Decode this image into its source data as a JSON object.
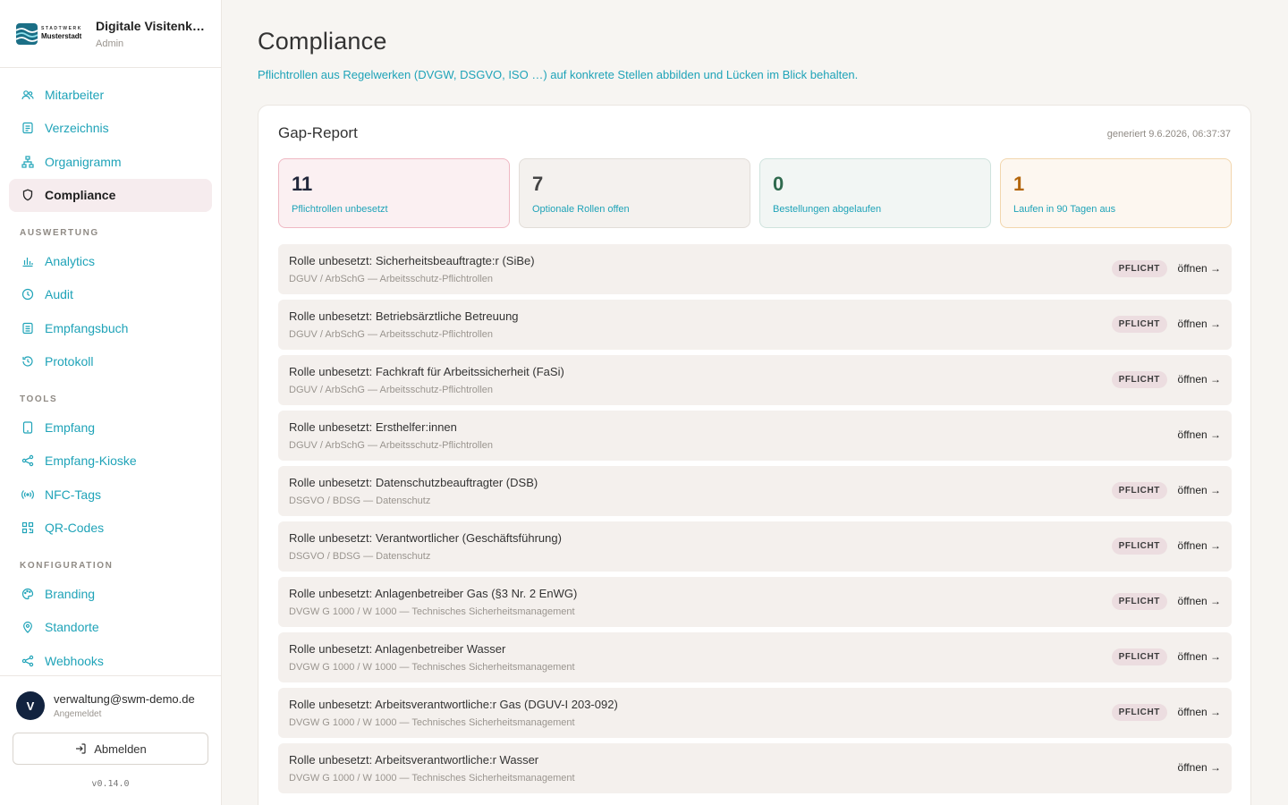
{
  "brand": {
    "logo_small": "STADTWERK",
    "logo_big": "Musterstadt",
    "title": "Digitale Visitenkarten",
    "subtitle": "Admin"
  },
  "nav": {
    "items_main": [
      {
        "label": "Mitarbeiter",
        "icon": "users-icon"
      },
      {
        "label": "Verzeichnis",
        "icon": "list-icon"
      },
      {
        "label": "Organigramm",
        "icon": "org-chart-icon"
      },
      {
        "label": "Compliance",
        "icon": "shield-icon",
        "active": true
      }
    ],
    "section_auswertung": "AUSWERTUNG",
    "items_auswertung": [
      {
        "label": "Analytics",
        "icon": "bar-chart-icon"
      },
      {
        "label": "Audit",
        "icon": "clock-icon"
      },
      {
        "label": "Empfangsbuch",
        "icon": "document-icon"
      },
      {
        "label": "Protokoll",
        "icon": "history-icon"
      }
    ],
    "section_tools": "TOOLS",
    "items_tools": [
      {
        "label": "Empfang",
        "icon": "tablet-icon"
      },
      {
        "label": "Empfang-Kioske",
        "icon": "share-icon"
      },
      {
        "label": "NFC-Tags",
        "icon": "nfc-icon"
      },
      {
        "label": "QR-Codes",
        "icon": "qr-icon"
      }
    ],
    "section_konfiguration": "KONFIGURATION",
    "items_konfiguration": [
      {
        "label": "Branding",
        "icon": "palette-icon"
      },
      {
        "label": "Standorte",
        "icon": "map-pin-icon"
      },
      {
        "label": "Webhooks",
        "icon": "webhook-icon"
      }
    ]
  },
  "user": {
    "initial": "V",
    "email": "verwaltung@swm-demo.de",
    "status": "Angemeldet",
    "logout_label": "Abmelden",
    "version": "v0.14.0"
  },
  "page": {
    "title": "Compliance",
    "subtitle": "Pflichtrollen aus Regelwerken (DVGW, DSGVO, ISO …) auf konkrete Stellen abbilden und Lücken im Blick behalten."
  },
  "report": {
    "title": "Gap-Report",
    "generated": "generiert 9.6.2026, 06:37:37",
    "stats": [
      {
        "value": "11",
        "label": "Pflichtrollen unbesetzt"
      },
      {
        "value": "7",
        "label": "Optionale Rollen offen"
      },
      {
        "value": "0",
        "label": "Bestellungen abgelaufen"
      },
      {
        "value": "1",
        "label": "Laufen in 90 Tagen aus"
      }
    ],
    "badge_label": "PFLICHT",
    "open_label": "öffnen →",
    "rows": [
      {
        "title": "Rolle unbesetzt: Sicherheitsbeauftragte:r (SiBe)",
        "source": "DGUV / ArbSchG — Arbeitsschutz-Pflichtrollen",
        "required": true
      },
      {
        "title": "Rolle unbesetzt: Betriebsärztliche Betreuung",
        "source": "DGUV / ArbSchG — Arbeitsschutz-Pflichtrollen",
        "required": true
      },
      {
        "title": "Rolle unbesetzt: Fachkraft für Arbeitssicherheit (FaSi)",
        "source": "DGUV / ArbSchG — Arbeitsschutz-Pflichtrollen",
        "required": true
      },
      {
        "title": "Rolle unbesetzt: Ersthelfer:innen",
        "source": "DGUV / ArbSchG — Arbeitsschutz-Pflichtrollen",
        "required": false
      },
      {
        "title": "Rolle unbesetzt: Datenschutzbeauftragter (DSB)",
        "source": "DSGVO / BDSG — Datenschutz",
        "required": true
      },
      {
        "title": "Rolle unbesetzt: Verantwortlicher (Geschäftsführung)",
        "source": "DSGVO / BDSG — Datenschutz",
        "required": true
      },
      {
        "title": "Rolle unbesetzt: Anlagenbetreiber Gas (§3 Nr. 2 EnWG)",
        "source": "DVGW G 1000 / W 1000 — Technisches Sicherheitsmanagement",
        "required": true
      },
      {
        "title": "Rolle unbesetzt: Anlagenbetreiber Wasser",
        "source": "DVGW G 1000 / W 1000 — Technisches Sicherheitsmanagement",
        "required": true
      },
      {
        "title": "Rolle unbesetzt: Arbeitsverantwortliche:r Gas (DGUV-I 203-092)",
        "source": "DVGW G 1000 / W 1000 — Technisches Sicherheitsmanagement",
        "required": true
      },
      {
        "title": "Rolle unbesetzt: Arbeitsverantwortliche:r Wasser",
        "source": "DVGW G 1000 / W 1000 — Technisches Sicherheitsmanagement",
        "required": false
      }
    ]
  },
  "colors": {
    "accent": "#1fa3b8",
    "active_bg": "#f6ecee",
    "badge_bg": "#ecdde0",
    "stat_red_border": "#efb8c3",
    "stat_green_text": "#2f6a4e",
    "stat_amber_text": "#b3650a"
  }
}
